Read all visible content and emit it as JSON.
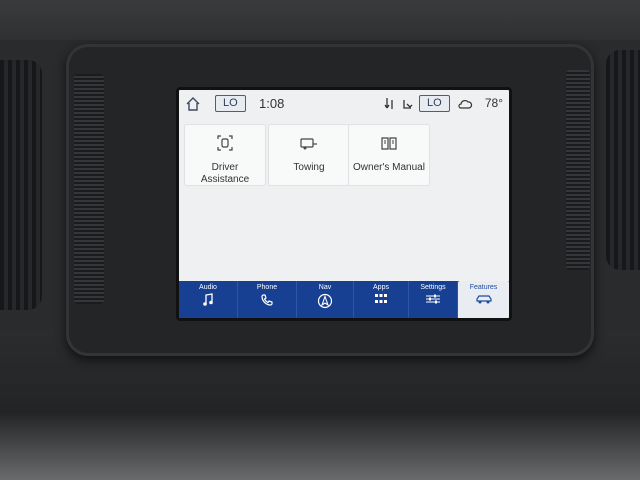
{
  "status": {
    "home_icon": "home-icon",
    "driver_temp_mode": "LO",
    "time": "1:08",
    "passenger_temp_mode": "LO",
    "outside_temp": "78°"
  },
  "tiles": [
    {
      "label": "Driver Assistance",
      "icon": "driver-assist-icon"
    },
    {
      "label": "Towing",
      "icon": "towing-icon"
    },
    {
      "label": "Owner's Manual",
      "icon": "book-icon"
    }
  ],
  "nav": {
    "audio": "Audio",
    "phone": "Phone",
    "nav": "Nav",
    "apps": "Apps",
    "settings": "Settings",
    "features": "Features",
    "active": "Features"
  },
  "colors": {
    "nav_bar": "#173f92",
    "screen_bg": "#eef0f1",
    "pill_border": "#4d5d7a"
  }
}
